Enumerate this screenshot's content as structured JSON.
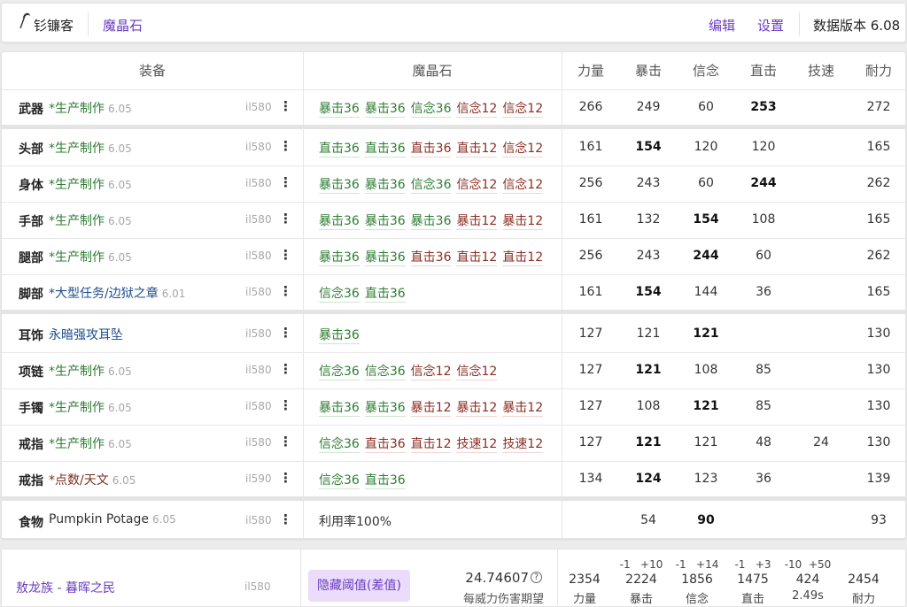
{
  "topbar": {
    "app_name": "钐镰客",
    "section": "魔晶石",
    "edit": "编辑",
    "settings": "设置",
    "version": "数据版本 6.08"
  },
  "headers": {
    "gear": "装备",
    "materia": "魔晶石",
    "str": "力量",
    "crit": "暴击",
    "det": "信念",
    "dh": "直击",
    "sks": "技速",
    "vit": "耐力"
  },
  "rows": [
    {
      "slot": "武器",
      "name": "*生产制作",
      "ver": "6.05",
      "il": "il580",
      "materia": [
        [
          "暴击36",
          "g"
        ],
        [
          "暴击36",
          "g"
        ],
        [
          "信念36",
          "g"
        ],
        [
          "信念12",
          "r"
        ],
        [
          "信念12",
          "r"
        ]
      ],
      "stats": [
        "266",
        "249",
        "60",
        "253",
        "",
        "272"
      ],
      "bold": [
        3
      ]
    },
    {
      "slot": "头部",
      "name": "*生产制作",
      "ver": "6.05",
      "il": "il580",
      "materia": [
        [
          "直击36",
          "g"
        ],
        [
          "直击36",
          "g"
        ],
        [
          "直击36",
          "r"
        ],
        [
          "直击12",
          "r"
        ],
        [
          "信念12",
          "r"
        ]
      ],
      "stats": [
        "161",
        "154",
        "120",
        "120",
        "",
        "165"
      ],
      "bold": [
        1
      ]
    },
    {
      "slot": "身体",
      "name": "*生产制作",
      "ver": "6.05",
      "il": "il580",
      "materia": [
        [
          "暴击36",
          "g"
        ],
        [
          "暴击36",
          "g"
        ],
        [
          "信念36",
          "g"
        ],
        [
          "信念12",
          "r"
        ],
        [
          "信念12",
          "r"
        ]
      ],
      "stats": [
        "256",
        "243",
        "60",
        "244",
        "",
        "262"
      ],
      "bold": [
        3
      ]
    },
    {
      "slot": "手部",
      "name": "*生产制作",
      "ver": "6.05",
      "il": "il580",
      "materia": [
        [
          "暴击36",
          "g"
        ],
        [
          "暴击36",
          "g"
        ],
        [
          "暴击36",
          "g"
        ],
        [
          "暴击12",
          "r"
        ],
        [
          "暴击12",
          "r"
        ]
      ],
      "stats": [
        "161",
        "132",
        "154",
        "108",
        "",
        "165"
      ],
      "bold": [
        2
      ]
    },
    {
      "slot": "腿部",
      "name": "*生产制作",
      "ver": "6.05",
      "il": "il580",
      "materia": [
        [
          "暴击36",
          "g"
        ],
        [
          "暴击36",
          "g"
        ],
        [
          "直击36",
          "r"
        ],
        [
          "直击12",
          "r"
        ],
        [
          "直击12",
          "r"
        ]
      ],
      "stats": [
        "256",
        "243",
        "244",
        "60",
        "",
        "262"
      ],
      "bold": [
        2
      ]
    },
    {
      "slot": "脚部",
      "name": "*大型任务/边狱之章",
      "ver": "6.01",
      "il": "il580",
      "materia": [
        [
          "信念36",
          "g"
        ],
        [
          "直击36",
          "g"
        ]
      ],
      "stats": [
        "161",
        "154",
        "144",
        "36",
        "",
        "165"
      ],
      "bold": [
        1
      ]
    },
    {
      "slot": "耳饰",
      "name": "永暗强攻耳坠",
      "ver": "",
      "il": "il580",
      "materia": [
        [
          "暴击36",
          "g"
        ]
      ],
      "stats": [
        "127",
        "121",
        "121",
        "",
        "",
        "130"
      ],
      "bold": [
        2
      ]
    },
    {
      "slot": "项链",
      "name": "*生产制作",
      "ver": "6.05",
      "il": "il580",
      "materia": [
        [
          "信念36",
          "g"
        ],
        [
          "信念36",
          "g"
        ],
        [
          "信念12",
          "r"
        ],
        [
          "信念12",
          "r"
        ]
      ],
      "stats": [
        "127",
        "121",
        "108",
        "85",
        "",
        "130"
      ],
      "bold": [
        1
      ]
    },
    {
      "slot": "手镯",
      "name": "*生产制作",
      "ver": "6.05",
      "il": "il580",
      "materia": [
        [
          "暴击36",
          "g"
        ],
        [
          "暴击36",
          "g"
        ],
        [
          "暴击12",
          "r"
        ],
        [
          "暴击12",
          "r"
        ],
        [
          "暴击12",
          "r"
        ]
      ],
      "stats": [
        "127",
        "108",
        "121",
        "85",
        "",
        "130"
      ],
      "bold": [
        2
      ]
    },
    {
      "slot": "戒指",
      "name": "*生产制作",
      "ver": "6.05",
      "il": "il580",
      "materia": [
        [
          "信念36",
          "g"
        ],
        [
          "直击36",
          "r"
        ],
        [
          "直击12",
          "r"
        ],
        [
          "技速12",
          "r"
        ],
        [
          "技速12",
          "r"
        ]
      ],
      "stats": [
        "127",
        "121",
        "121",
        "48",
        "24",
        "130"
      ],
      "bold": [
        1
      ]
    },
    {
      "slot": "戒指",
      "name": "*点数/天文",
      "ver": "6.05",
      "il": "il590",
      "materia": [
        [
          "信念36",
          "g"
        ],
        [
          "直击36",
          "g"
        ]
      ],
      "stats": [
        "134",
        "124",
        "123",
        "36",
        "",
        "139"
      ],
      "bold": [
        1
      ]
    },
    {
      "slot": "食物",
      "name": "Pumpkin Potage",
      "ver": "6.05",
      "il": "il580",
      "plain": "利用率100%",
      "stats": [
        "",
        "54",
        "90",
        "",
        "",
        "93"
      ],
      "bold": [
        2
      ]
    }
  ],
  "bottom": {
    "job": "敖龙族 - 暮晖之民",
    "il": "il580",
    "badge": "隐藏阈值(差值)",
    "damage": "24.74607",
    "damage_label": "每威力伤害期望",
    "help": "?",
    "stats": [
      {
        "delta": "",
        "value": "2354",
        "label": "力量"
      },
      {
        "delta": "-1   +10",
        "value": "2224",
        "label": "暴击"
      },
      {
        "delta": "-1   +14",
        "value": "1856",
        "label": "信念"
      },
      {
        "delta": "-1   +3",
        "value": "1475",
        "label": "直击"
      },
      {
        "delta": "-10  +50",
        "value": "424",
        "label": "2.49s"
      },
      {
        "delta": "",
        "value": "2454",
        "label": "耐力"
      }
    ]
  },
  "colors": {
    "accent": "#6a3cbf",
    "craft": "#2e7d32",
    "raid": "#1e4b8c",
    "tome": "#7a2e1f"
  }
}
